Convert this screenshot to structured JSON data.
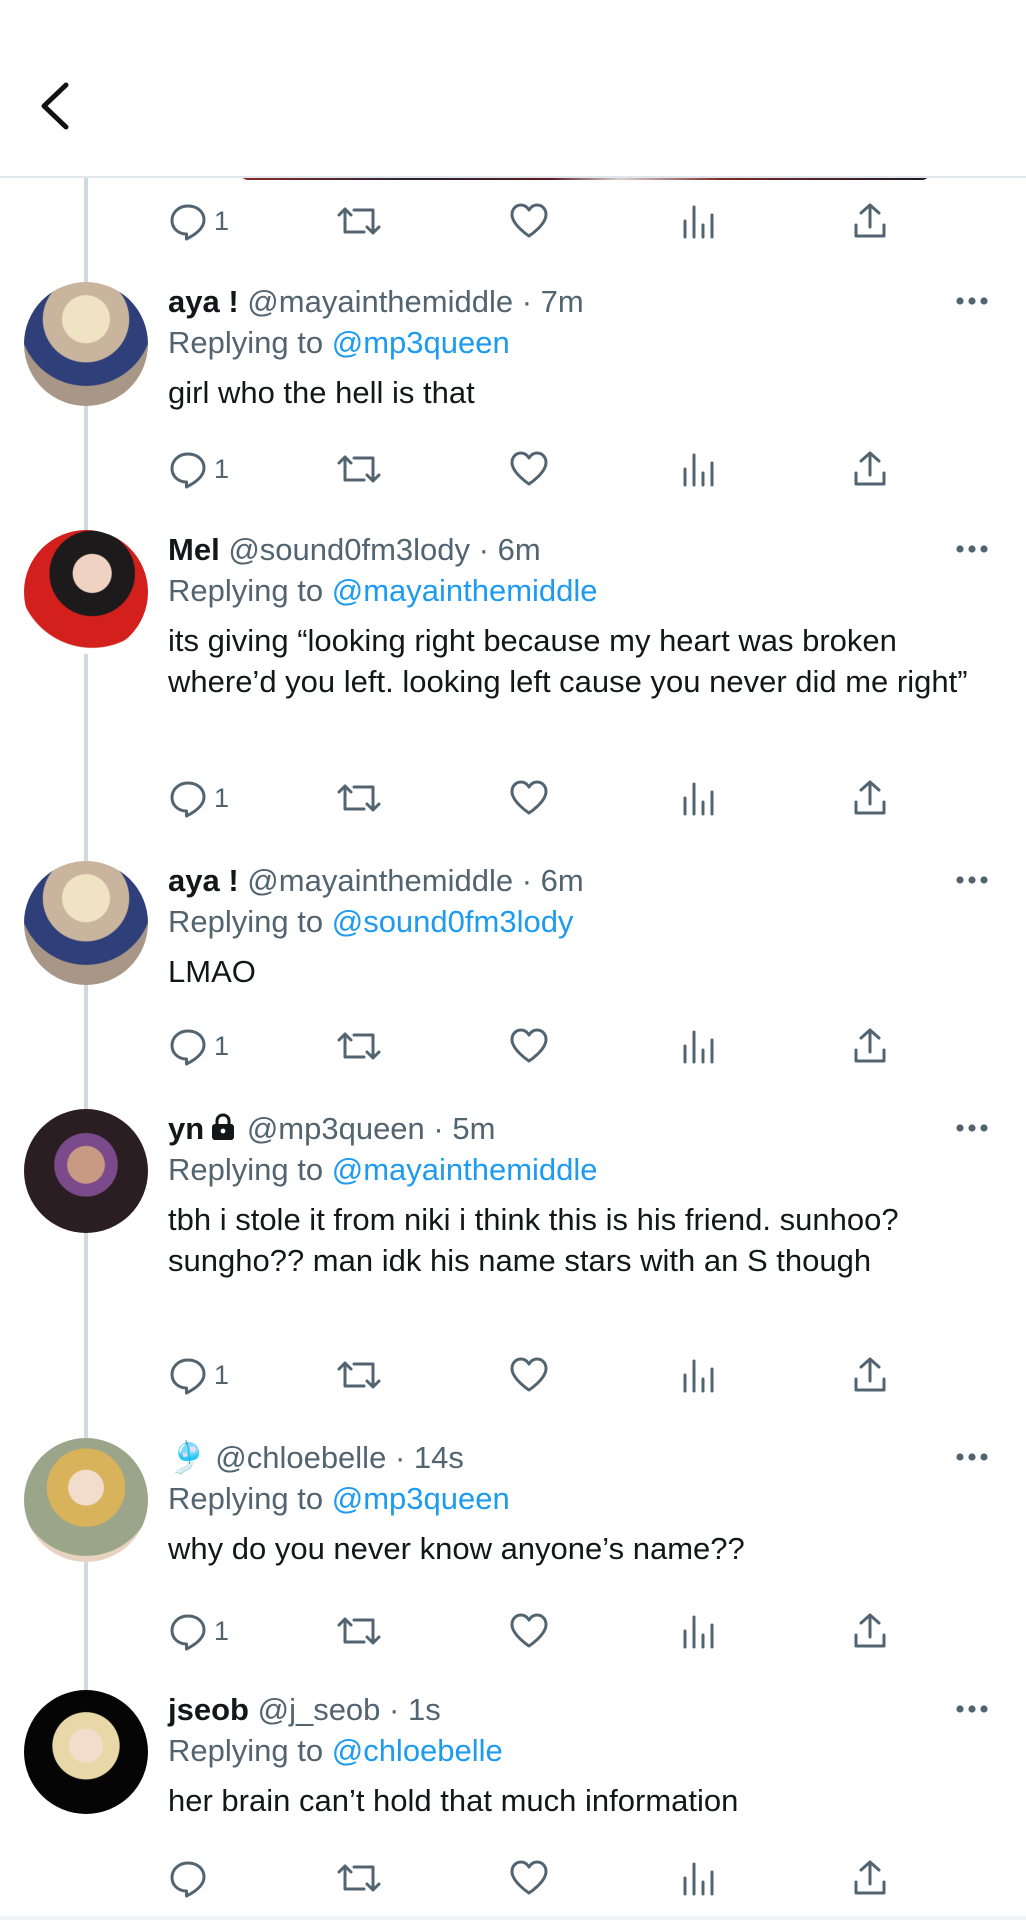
{
  "header": {
    "back_icon": "chevron-left-icon"
  },
  "top_actions": {
    "reply_count": "1"
  },
  "tweets": [
    {
      "name": "aya !",
      "handle": "@mayainthemiddle",
      "time": "· 7m",
      "replying_prefix": "Replying to",
      "replying_to": "@mp3queen",
      "text": "girl who the hell is that",
      "reply_count": "1",
      "avatar_colors": [
        "#c9b49d",
        "#2f3f7a",
        "#efe3c3"
      ]
    },
    {
      "name": "Mel",
      "handle": "@sound0fm3lody",
      "time": "· 6m",
      "replying_prefix": "Replying to",
      "replying_to": "@mayainthemiddle",
      "text": "its giving “looking right because my heart was broken where’d you left. looking left cause you never did me right”",
      "reply_count": "1",
      "avatar_colors": [
        "#1c1a1b",
        "#d4201c",
        "#f0d2c2"
      ]
    },
    {
      "name": "aya !",
      "handle": "@mayainthemiddle",
      "time": "· 6m",
      "replying_prefix": "Replying to",
      "replying_to": "@sound0fm3lody",
      "text": "LMAO",
      "reply_count": "1",
      "avatar_colors": [
        "#c9b49d",
        "#2f3f7a",
        "#efe3c3"
      ]
    },
    {
      "name": "yn",
      "protected": true,
      "handle": "@mp3queen",
      "time": "· 5m",
      "replying_prefix": "Replying to",
      "replying_to": "@mayainthemiddle",
      "text": "tbh i stole it from niki i think this is his friend. sunhoo? sungho?? man idk his name stars with an S though",
      "reply_count": "1",
      "avatar_colors": [
        "#2a1e22",
        "#7a4a8a",
        "#c89a83"
      ]
    },
    {
      "name": "🎐",
      "handle": "@chloebelle",
      "time": "· 14s",
      "replying_prefix": "Replying to",
      "replying_to": "@mp3queen",
      "text": "why do you never know anyone’s name??",
      "reply_count": "1",
      "avatar_colors": [
        "#e7d3c0",
        "#d9b25c",
        "#9aa58a"
      ]
    },
    {
      "name": "jseob",
      "handle": "@j_seob",
      "time": "· 1s",
      "replying_prefix": "Replying to",
      "replying_to": "@chloebelle",
      "text": "her brain can’t hold that much information",
      "reply_count": "",
      "avatar_colors": [
        "#050505",
        "#e8d8a8",
        "#f2dccb"
      ]
    }
  ],
  "icons": {
    "reply": "reply-icon",
    "retweet": "retweet-icon",
    "like": "heart-icon",
    "views": "views-icon",
    "share": "share-icon",
    "more": "more-icon"
  },
  "colors": {
    "link": "#1d9bf0",
    "secondary": "#536471",
    "primary_text": "#14171a",
    "thread_line": "#cfd9de"
  }
}
